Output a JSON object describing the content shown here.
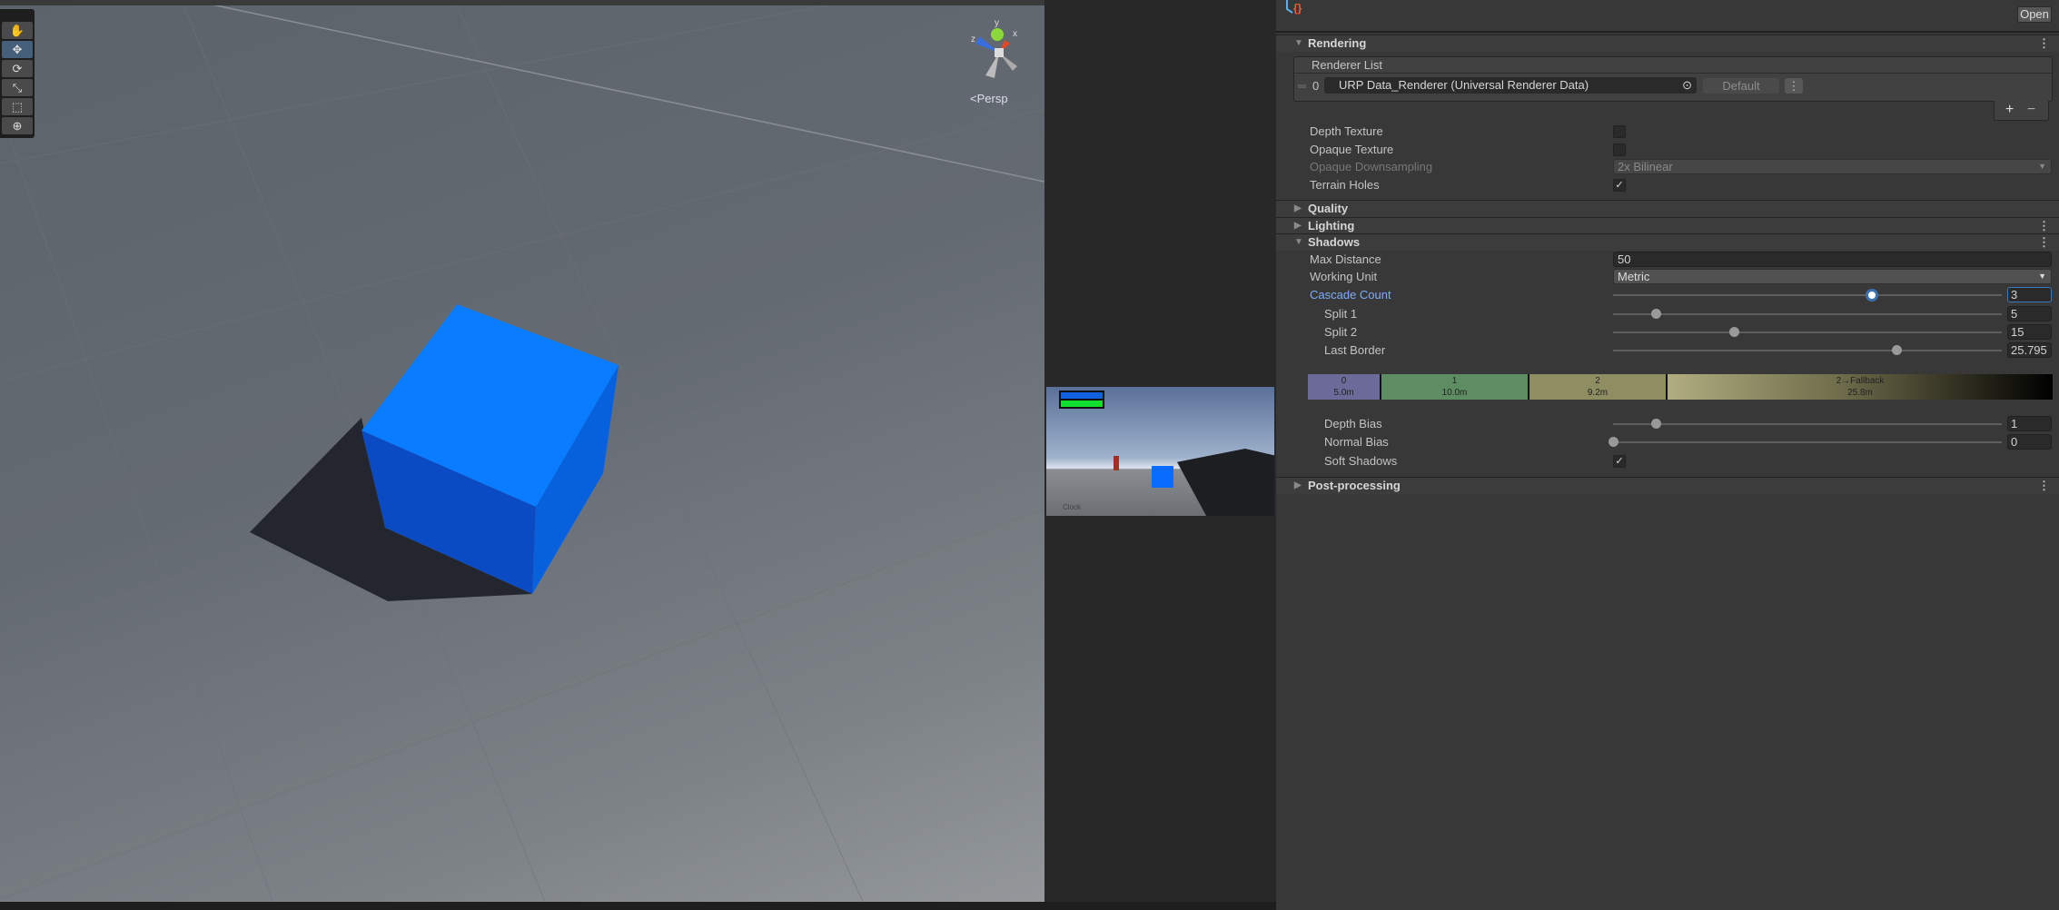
{
  "scene": {
    "tools": [
      "hand-tool",
      "move-tool",
      "rotate-tool",
      "scale-tool",
      "rect-tool",
      "transform-tool"
    ],
    "active_tool": "move-tool",
    "projection_label": "<Persp",
    "gizmo_axes": {
      "x": "x",
      "y": "y",
      "z": "z"
    },
    "cube_color": "#0a7cff"
  },
  "game_view": {
    "hud_label": "Clock"
  },
  "inspector": {
    "open_button": "Open",
    "rendering": {
      "title": "Rendering",
      "renderer_list": {
        "title": "Renderer List",
        "items": [
          {
            "index": "0",
            "name": "URP Data_Renderer (Universal Renderer Data)",
            "default_label": "Default"
          }
        ],
        "add": "+",
        "remove": "−"
      },
      "depth_texture": {
        "label": "Depth Texture",
        "checked": false
      },
      "opaque_texture": {
        "label": "Opaque Texture",
        "checked": false
      },
      "opaque_downsampling": {
        "label": "Opaque Downsampling",
        "value": "2x Bilinear"
      },
      "terrain_holes": {
        "label": "Terrain Holes",
        "checked": true
      }
    },
    "quality": {
      "title": "Quality"
    },
    "lighting": {
      "title": "Lighting"
    },
    "shadows": {
      "title": "Shadows",
      "max_distance": {
        "label": "Max Distance",
        "value": "50"
      },
      "working_unit": {
        "label": "Working Unit",
        "value": "Metric"
      },
      "cascade_count": {
        "label": "Cascade Count",
        "value": "3",
        "fraction": 0.667
      },
      "split1": {
        "label": "Split 1",
        "value": "5",
        "fraction": 0.11
      },
      "split2": {
        "label": "Split 2",
        "value": "15",
        "fraction": 0.31
      },
      "last_border": {
        "label": "Last Border",
        "value": "25.795",
        "fraction": 0.73
      },
      "cascades": [
        {
          "name": "0",
          "dist": "5.0m",
          "color": "#6b6a98"
        },
        {
          "name": "1",
          "dist": "10.0m",
          "color": "#5f8d63"
        },
        {
          "name": "2",
          "dist": "9.2m",
          "color": "#8f8d62"
        },
        {
          "name": "2→Fallback",
          "dist": "25.8m",
          "color": "#b0ad80"
        }
      ],
      "depth_bias": {
        "label": "Depth Bias",
        "value": "1",
        "fraction": 0.11
      },
      "normal_bias": {
        "label": "Normal Bias",
        "value": "0",
        "fraction": 0.0
      },
      "soft_shadows": {
        "label": "Soft Shadows",
        "checked": true
      }
    },
    "post_processing": {
      "title": "Post-processing"
    }
  }
}
